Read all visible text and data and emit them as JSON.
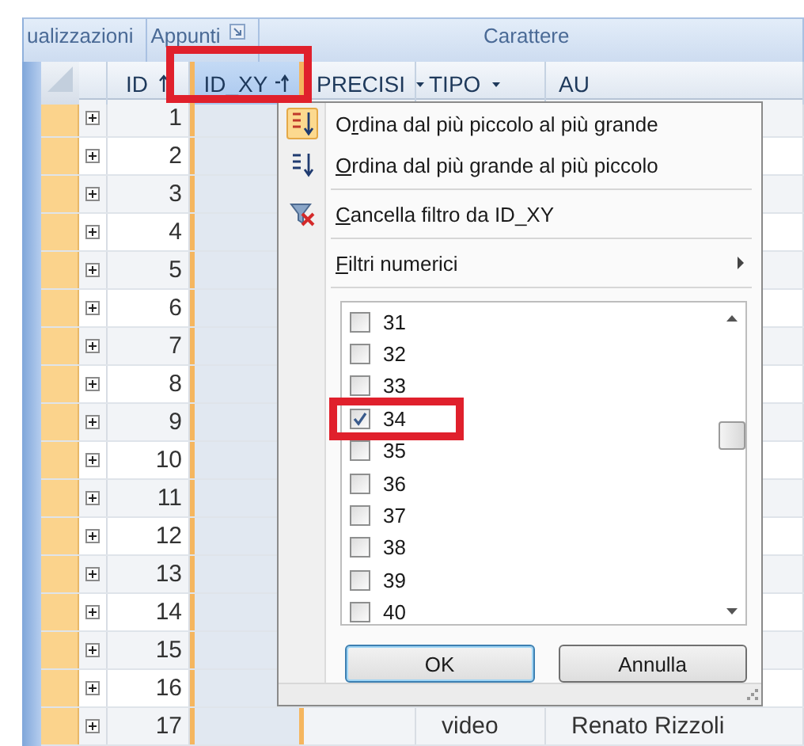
{
  "ribbon": {
    "groups": [
      {
        "label": "ualizzazioni",
        "launcher": false
      },
      {
        "label": "Appunti",
        "launcher": true
      },
      {
        "label": "Carattere",
        "launcher": false
      }
    ]
  },
  "table": {
    "columns": [
      {
        "label": "ID",
        "kind": "sorted",
        "selected": false,
        "highlighted": false
      },
      {
        "label": "ID_XY",
        "kind": "filtered_sorted",
        "selected": true,
        "highlighted": true
      },
      {
        "label": "PRECISI",
        "kind": "dropdown",
        "selected": false,
        "highlighted": false
      },
      {
        "label": "TIPO",
        "kind": "dropdown",
        "selected": false,
        "highlighted": false
      },
      {
        "label": "AU",
        "selected": false,
        "highlighted": false
      }
    ],
    "rows": [
      {
        "number": "1",
        "expanded": false
      },
      {
        "number": "2",
        "expanded": false
      },
      {
        "number": "3",
        "expanded": false
      },
      {
        "number": "4",
        "expanded": false
      },
      {
        "number": "5",
        "expanded": false
      },
      {
        "number": "6",
        "expanded": false
      },
      {
        "number": "7",
        "expanded": false
      },
      {
        "number": "8",
        "expanded": false
      },
      {
        "number": "9",
        "expanded": false
      },
      {
        "number": "10",
        "expanded": false
      },
      {
        "number": "11",
        "expanded": false
      },
      {
        "number": "12",
        "expanded": false
      },
      {
        "number": "13",
        "expanded": false
      },
      {
        "number": "14",
        "expanded": false
      },
      {
        "number": "15",
        "expanded": false
      },
      {
        "number": "16",
        "expanded": false
      },
      {
        "number": "17",
        "expanded": false,
        "tipo": "video",
        "column_5": "Renato Rizzoli"
      }
    ]
  },
  "filter_menu": {
    "items": [
      {
        "kind": "sort_asc",
        "before": "O",
        "access_key": "r",
        "after": "dina dal più piccolo al più grande",
        "checked": true
      },
      {
        "kind": "sort_desc",
        "access_key": "O",
        "after": "rdina dal più grande al più piccolo",
        "checked": false
      },
      {
        "kind": "clear_filter",
        "access_key": "C",
        "after": "ancella filtro da ID_XY",
        "checked": false
      },
      {
        "kind": "submenu",
        "access_key": "F",
        "after": "iltri numerici",
        "checked": false
      }
    ],
    "values": [
      {
        "label": "31",
        "checked": false,
        "highlighted": false
      },
      {
        "label": "32",
        "checked": false,
        "highlighted": false
      },
      {
        "label": "33",
        "checked": false,
        "highlighted": false
      },
      {
        "label": "34",
        "checked": true,
        "highlighted": true
      },
      {
        "label": "35",
        "checked": false,
        "highlighted": false
      },
      {
        "label": "36",
        "checked": false,
        "highlighted": false
      },
      {
        "label": "37",
        "checked": false,
        "highlighted": false
      },
      {
        "label": "38",
        "checked": false,
        "highlighted": false
      },
      {
        "label": "39",
        "checked": false,
        "highlighted": false
      },
      {
        "label": "40",
        "checked": false,
        "highlighted": false
      }
    ],
    "buttons": [
      {
        "label": "OK",
        "focused": true
      },
      {
        "label": "Annulla",
        "focused": false
      }
    ]
  }
}
